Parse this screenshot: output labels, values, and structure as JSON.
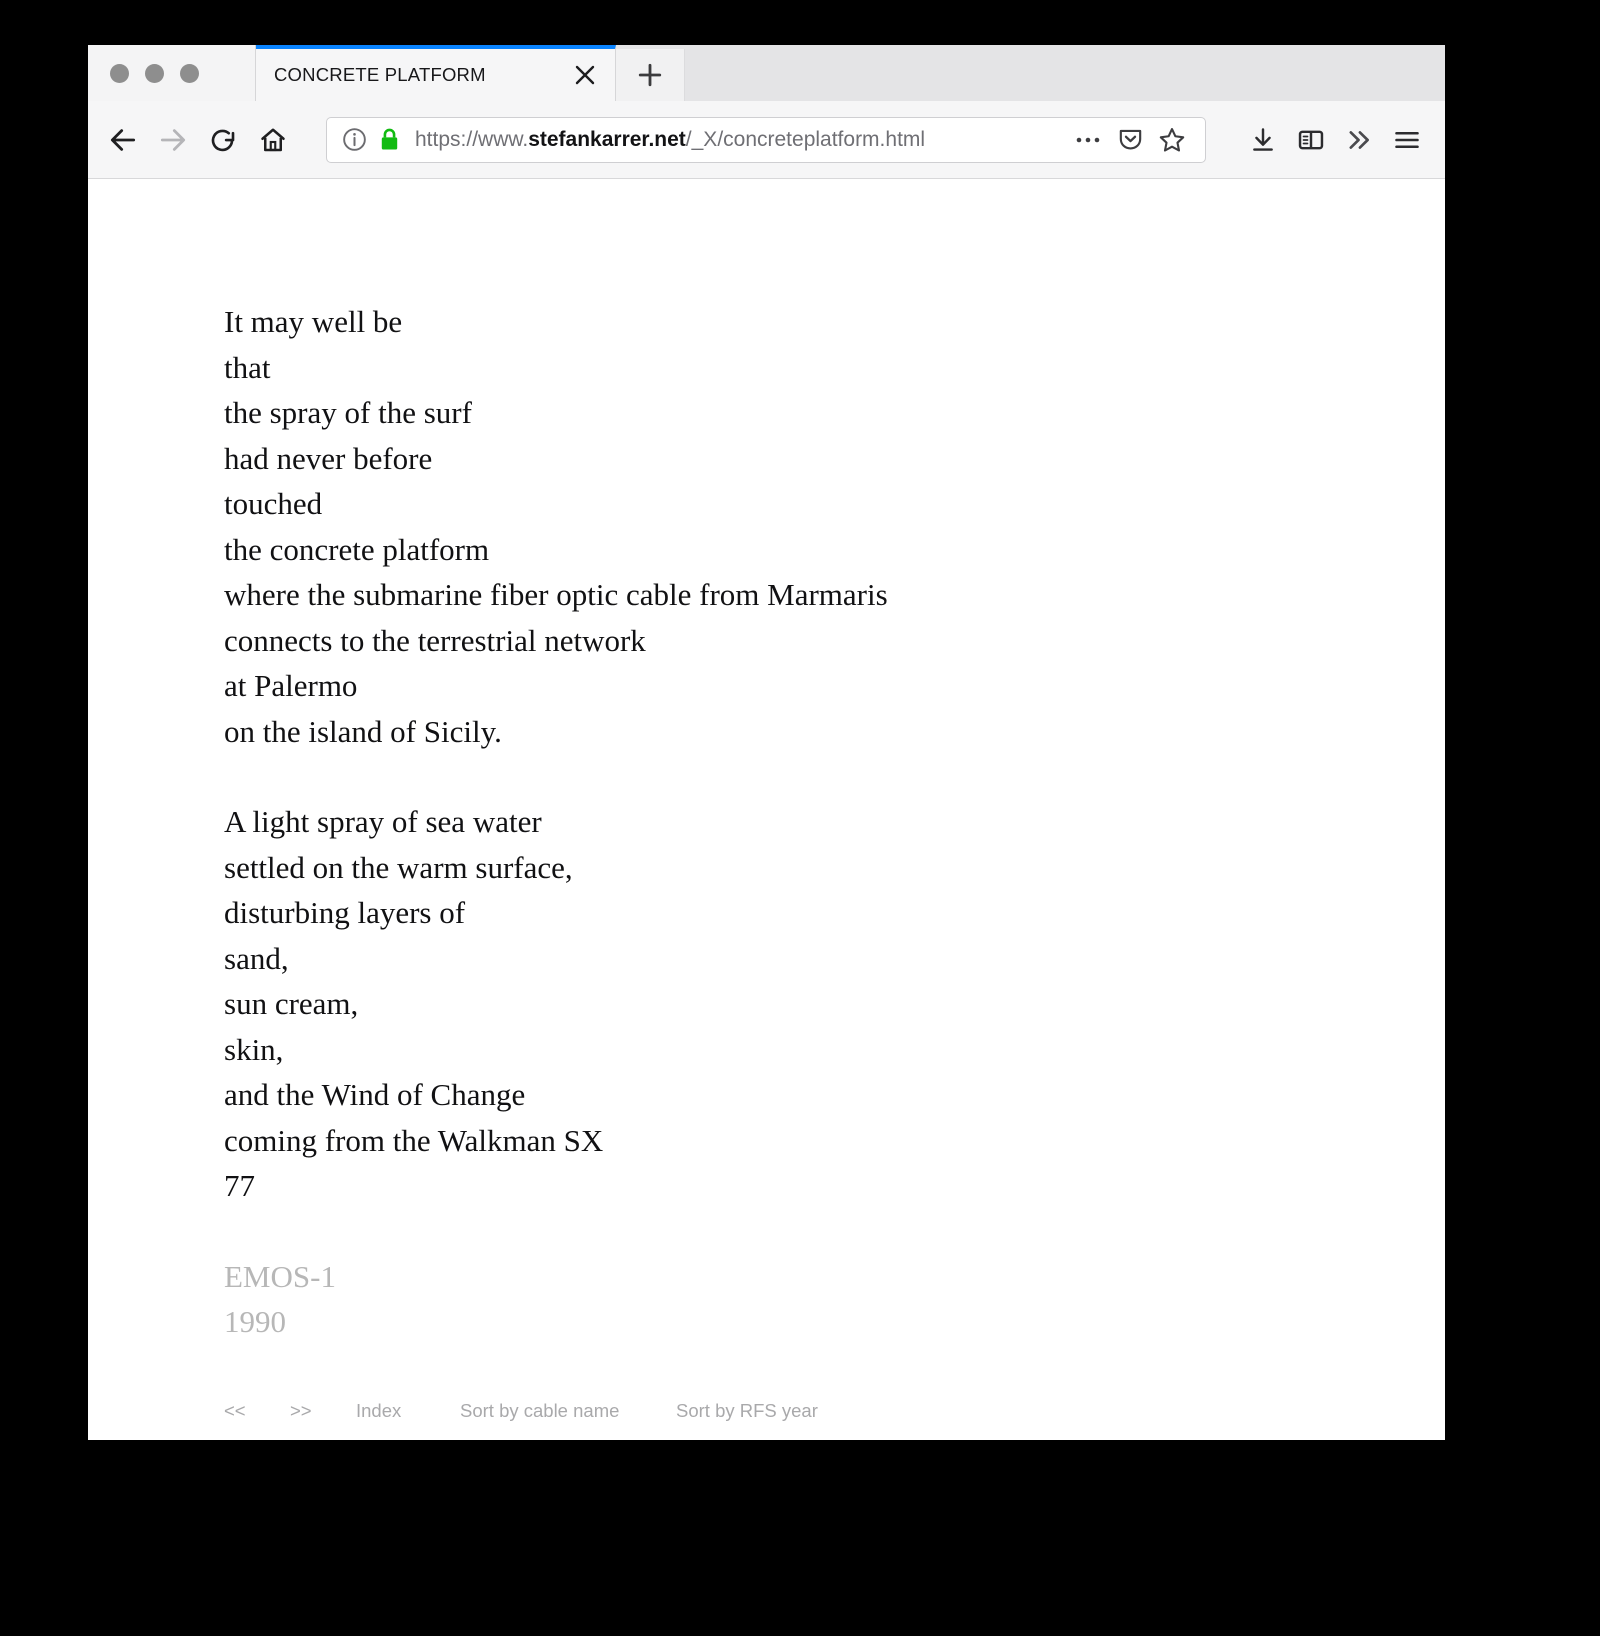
{
  "window": {
    "traffic_lights": [
      "close-button",
      "minimize-button",
      "zoom-button"
    ]
  },
  "tab_bar": {
    "active_tab_title": "CONCRETE PLATFORM",
    "close_tab_icon": "close-icon",
    "new_tab_icon": "plus-icon"
  },
  "toolbar": {
    "back_icon": "back-arrow-icon",
    "forward_icon": "forward-arrow-icon",
    "reload_icon": "reload-icon",
    "home_icon": "home-icon",
    "identity_icon": "info-circle-icon",
    "lock_icon": "padlock-icon",
    "url_full": "https://www.stefankarrer.net/_X/concreteplatform.html",
    "url_prefix": "https://www.",
    "url_domain": "stefankarrer.net",
    "url_path": "/_X/concreteplatform.html",
    "page_actions_icon": "ellipsis-icon",
    "pocket_icon": "pocket-shield-icon",
    "bookmark_icon": "star-icon",
    "downloads_icon": "download-arrow-icon",
    "sidebar_icon": "library-sidebar-icon",
    "overflow_icon": "double-chevron-right-icon",
    "menu_icon": "hamburger-menu-icon",
    "lock_color": "#12bb12",
    "accent_color": "#0a84ff"
  },
  "page": {
    "poem": {
      "stanzas": [
        [
          "It may well be",
          "that",
          "the spray of the surf",
          "had never before",
          "touched",
          "the concrete platform",
          "where the submarine fiber optic cable from Marmaris",
          "connects to the terrestrial network",
          "at Palermo",
          "on the island of Sicily."
        ],
        [
          "A light spray of sea water",
          "settled on the warm surface,",
          "disturbing layers of",
          "sand,",
          "sun cream,",
          "skin,",
          "and the Wind of Change",
          "coming from the Walkman SX",
          "77"
        ]
      ]
    },
    "cable": {
      "name": "EMOS-1",
      "rfs_year": "1990",
      "meta_color": "#b7b7b7"
    },
    "site_nav": {
      "prev_label": "<<",
      "next_label": ">>",
      "index_label": "Index",
      "sort_by_cable_name_label": "Sort by cable name",
      "sort_by_rfs_year_label": "Sort by RFS year",
      "link_color": "#a9a9ab"
    }
  }
}
